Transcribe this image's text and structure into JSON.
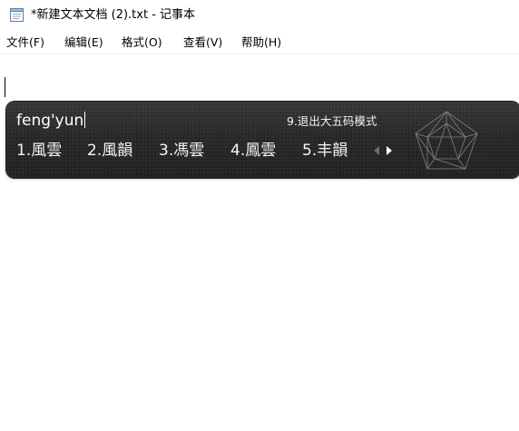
{
  "window": {
    "title": "*新建文本文档 (2).txt - 记事本",
    "app_icon": "notepad-icon"
  },
  "menu": {
    "items": [
      {
        "label": "文件(F)"
      },
      {
        "label": "编辑(E)"
      },
      {
        "label": "格式(O)"
      },
      {
        "label": "查看(V)"
      },
      {
        "label": "帮助(H)"
      }
    ]
  },
  "editor": {
    "content": ""
  },
  "ime": {
    "composition": "feng'yun",
    "hint": "9.退出大五码模式",
    "candidates": [
      {
        "label": "1.風雲"
      },
      {
        "label": "2.風韻"
      },
      {
        "label": "3.馮雲"
      },
      {
        "label": "4.鳳雲"
      },
      {
        "label": "5.丰韻"
      }
    ],
    "prev_icon": "triangle-left-icon",
    "next_icon": "triangle-right-icon",
    "logo_icon": "pentagon-logo-icon",
    "colors": {
      "background": "#2b2b2b",
      "text": "#ffffff",
      "arrow_disabled": "#6e6e6e"
    }
  }
}
